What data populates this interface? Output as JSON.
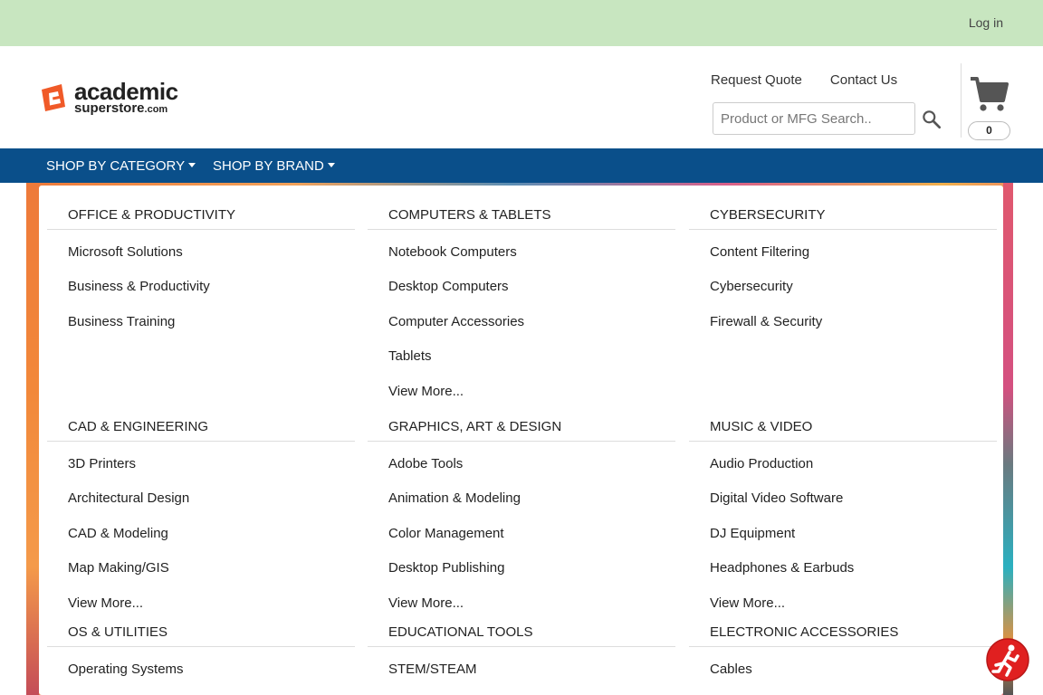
{
  "topbar": {
    "login": "Log in"
  },
  "header": {
    "logo": {
      "line1": "academic",
      "line2": "superstore",
      "line2_suffix": ".com"
    },
    "links": [
      "Request Quote",
      "Contact Us"
    ],
    "search": {
      "placeholder": "Product or MFG Search..",
      "value": ""
    },
    "cart_count": "0"
  },
  "nav": {
    "items": [
      "SHOP BY CATEGORY",
      "SHOP BY BRAND"
    ]
  },
  "menu": {
    "columns": [
      {
        "heading": "OFFICE & PRODUCTIVITY",
        "links": [
          "Microsoft Solutions",
          "Business & Productivity",
          "Business Training"
        ]
      },
      {
        "heading": "COMPUTERS & TABLETS",
        "links": [
          "Notebook Computers",
          "Desktop Computers",
          "Computer Accessories",
          "Tablets",
          "View More..."
        ]
      },
      {
        "heading": "CYBERSECURITY",
        "links": [
          "Content Filtering",
          "Cybersecurity",
          "Firewall & Security"
        ]
      },
      {
        "heading": "CAD & ENGINEERING",
        "links": [
          "3D Printers",
          "Architectural Design",
          "CAD & Modeling",
          "Map Making/GIS",
          "View More..."
        ]
      },
      {
        "heading": "GRAPHICS, ART & DESIGN",
        "links": [
          "Adobe Tools",
          "Animation & Modeling",
          "Color Management",
          "Desktop Publishing",
          "View More..."
        ]
      },
      {
        "heading": "MUSIC & VIDEO",
        "links": [
          "Audio Production",
          "Digital Video Software",
          "DJ Equipment",
          "Headphones & Earbuds",
          "View More..."
        ]
      },
      {
        "heading": "OS & UTILITIES",
        "links": [
          "Operating Systems"
        ]
      },
      {
        "heading": "EDUCATIONAL TOOLS",
        "links": [
          "STEM/STEAM"
        ]
      },
      {
        "heading": "ELECTRONIC ACCESSORIES",
        "links": [
          "Cables"
        ]
      }
    ]
  },
  "colors": {
    "topbar": "#c8e6c0",
    "nav": "#0a4f8a",
    "brand_orange": "#f05a28",
    "help_red": "#e02020"
  },
  "icons": {
    "search": "search-icon",
    "cart": "cart-icon",
    "help": "help-runner-icon"
  }
}
